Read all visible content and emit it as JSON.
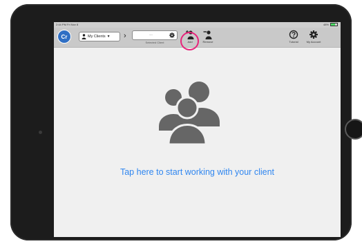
{
  "status_bar": {
    "time": "2:44 PM  Fri Nov 8",
    "battery": "48%"
  },
  "toolbar": {
    "logo_text": "Cr",
    "clients_dropdown": "My Clients",
    "selected_client_value": "---",
    "selected_client_caption": "Selected Client",
    "add_label": "Add",
    "remove_label": "Remove",
    "tutorial_label": "Tutorial",
    "account_label": "My Account"
  },
  "main": {
    "cta_text": "Tap here to start working with your client"
  },
  "colors": {
    "highlight_ring": "#e8227a",
    "cta": "#2f86f0",
    "logo": "#2f6fc4"
  },
  "icons": [
    "person-icon",
    "chevron-down-icon",
    "chevron-right-icon",
    "gear-icon",
    "add-user-icon",
    "remove-user-icon",
    "help-icon",
    "account-gear-icon",
    "client-group-icon"
  ]
}
